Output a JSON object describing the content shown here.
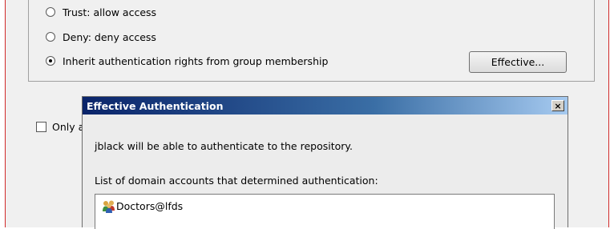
{
  "options": {
    "trust_label": "Trust: allow access",
    "deny_label": "Deny: deny access",
    "inherit_label": "Inherit authentication rights from group membership",
    "effective_button": "Effective...",
    "only_checkbox_label": "Only a"
  },
  "dialog": {
    "title": "Effective Authentication",
    "close_glyph": "×",
    "message": "jblack will be able to authenticate to the repository.",
    "list_label": "List of domain accounts that determined authentication:",
    "accounts": [
      "Doctors@lfds"
    ]
  },
  "colors": {
    "title_gradient_start": "#0a246a",
    "title_gradient_end": "#a6caf0",
    "window_border_red": "#d12a2a"
  }
}
